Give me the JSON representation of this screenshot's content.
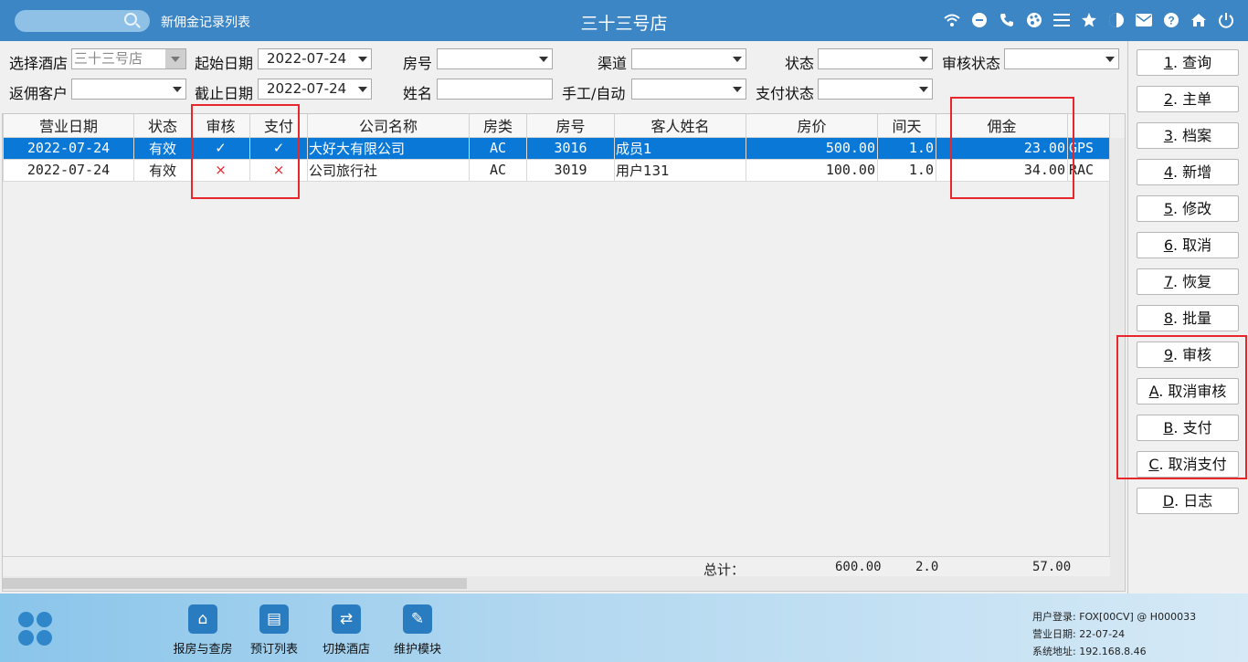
{
  "header": {
    "breadcrumb": "新佣金记录列表",
    "title": "三十三号店",
    "icons": [
      "wifi-icon",
      "chat-icon",
      "phone-icon",
      "palette-icon",
      "menu-icon",
      "star-icon",
      "contrast-icon",
      "mail-icon",
      "help-icon",
      "home-icon",
      "power-icon"
    ]
  },
  "filters": {
    "hotel_label": "选择酒店",
    "hotel_value": "三十三号店",
    "start_label": "起始日期",
    "start_value": "2022-07-24",
    "end_label": "截止日期",
    "end_value": "2022-07-24",
    "room_label": "房号",
    "room_value": "",
    "channel_label": "渠道",
    "channel_value": "",
    "status_label": "状态",
    "status_value": "",
    "audit_status_label": "审核状态",
    "audit_status_value": "",
    "customer_label": "返佣客户",
    "customer_value": "",
    "name_label": "姓名",
    "name_value": "",
    "manual_label": "手工/自动",
    "manual_value": "",
    "pay_status_label": "支付状态",
    "pay_status_value": ""
  },
  "table": {
    "headers": [
      "营业日期",
      "状态",
      "审核",
      "支付",
      "公司名称",
      "房类",
      "房号",
      "客人姓名",
      "房价",
      "间天",
      "佣金"
    ],
    "rows": [
      {
        "date": "2022-07-24",
        "status": "有效",
        "audit": "✓",
        "pay": "✓",
        "company": "大好大有限公司",
        "room_type": "AC",
        "room_no": "3016",
        "guest": "成员1",
        "rate": "500.00",
        "nights": "1.0",
        "commission": "23.00",
        "extra": "GPS"
      },
      {
        "date": "2022-07-24",
        "status": "有效",
        "audit": "×",
        "pay": "×",
        "company": "公司旅行社",
        "room_type": "AC",
        "room_no": "3019",
        "guest": "用户131",
        "rate": "100.00",
        "nights": "1.0",
        "commission": "34.00",
        "extra": "RAC"
      }
    ],
    "totals": {
      "label": "总计：",
      "rate": "600.00",
      "nights": "2.0",
      "commission": "57.00"
    }
  },
  "buttons": [
    {
      "key": "1",
      "label": "查询"
    },
    {
      "key": "2",
      "label": "主单"
    },
    {
      "key": "3",
      "label": "档案"
    },
    {
      "key": "4",
      "label": "新增"
    },
    {
      "key": "5",
      "label": "修改"
    },
    {
      "key": "6",
      "label": "取消"
    },
    {
      "key": "7",
      "label": "恢复"
    },
    {
      "key": "8",
      "label": "批量"
    },
    {
      "key": "9",
      "label": "审核"
    },
    {
      "key": "A",
      "label": "取消审核"
    },
    {
      "key": "B",
      "label": "支付"
    },
    {
      "key": "C",
      "label": "取消支付"
    },
    {
      "key": "D",
      "label": "日志"
    }
  ],
  "bottom": {
    "nav": [
      "报房与查房",
      "预订列表",
      "切换酒店",
      "维护模块"
    ],
    "user_line": "用户登录:  FOX[00CV] @ H000033",
    "date_line": "营业日期:  22-07-24",
    "addr_line": "系统地址:  192.168.8.46"
  },
  "colors": {
    "topbar": "#3d86c6",
    "selected_row": "#0a78d7",
    "annotation": "#e8272c"
  }
}
